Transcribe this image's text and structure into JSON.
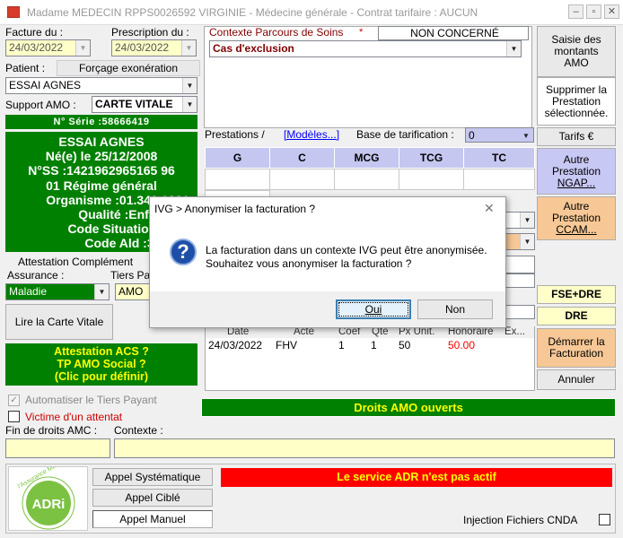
{
  "window": {
    "title": "Madame MEDECIN RPPS0026592 VIRGINIE - Médecine générale - Contrat tarifaire : AUCUN",
    "minimize_icon": "minimize-icon",
    "restore_icon": "restore-icon",
    "close_icon": "close-icon"
  },
  "left": {
    "facture_label": "Facture du :",
    "facture_date": "24/03/2022",
    "prescription_label": "Prescription du :",
    "prescription_date": "24/03/2022",
    "patient_label": "Patient :",
    "forcage_label": "Forçage exonération",
    "patient_name": "ESSAI AGNES",
    "support_label": "Support AMO :",
    "support_value": "CARTE VITALE",
    "serie": "N° Série :58666419",
    "card_lines": [
      "ESSAI AGNES",
      "Né(e) le 25/12/2008",
      "N°SS :1421962965165 96",
      "01 Régime général",
      "Organisme :01.349.0881",
      "Qualité :Enfant",
      "Code Situation :0",
      "Code Ald :3"
    ],
    "attestation_label": "Attestation Complément",
    "assurance_label": "Assurance :",
    "tiers_label": "Tiers Pa",
    "assurance_value": "Maladie",
    "tiers_value": "AMO",
    "lire_carte": "Lire la Carte Vitale",
    "acs_lines": [
      "Attestation ACS ?",
      "TP AMO Social ?",
      "(Clic pour définir)"
    ],
    "automatiser_label": "Automatiser le Tiers Payant",
    "victime_label": "Victime d'un attentat",
    "fin_droits_label": "Fin de droits AMC :",
    "contexte_label": "Contexte :"
  },
  "center": {
    "parcours_label": "Contexte Parcours de Soins",
    "non_concerne": "NON CONCERNÉ",
    "exclusion": "Cas d'exclusion",
    "prestations_label": "Prestations /",
    "modeles_link": "[Modèles...]",
    "base_label": "Base de tarification :",
    "base_value": "0",
    "grid_headers": [
      "G",
      "C",
      "MCG",
      "TCG",
      "TC"
    ],
    "acts_columns": [
      "Date",
      "Acte",
      "Coef",
      "Qté",
      "Px Unit.",
      "Honoraire",
      "Ex..."
    ],
    "acts_rows": [
      {
        "date": "24/03/2022",
        "acte": "FHV",
        "coef": "1",
        "qte": "1",
        "px": "50",
        "honoraire": "50.00",
        "ex": ""
      }
    ],
    "droits_amo": "Droits AMO ouverts"
  },
  "right": {
    "saisie": [
      "Saisie des",
      "montants",
      "AMO"
    ],
    "supprimer": [
      "Supprimer la",
      "Prestation",
      "sélectionnée."
    ],
    "tarifs": "Tarifs €",
    "autre_ngap": [
      "Autre",
      "Prestation",
      "NGAP..."
    ],
    "autre_ccam": [
      "Autre",
      "Prestation",
      "CCAM..."
    ],
    "fse_dre": "FSE+DRE",
    "dre": "DRE",
    "demarrer": [
      "Démarrer la",
      "Facturation"
    ],
    "annuler": "Annuler"
  },
  "bottom": {
    "adri_logo_text": "ADRi",
    "adri_ring_text": "l'Assurance Maladie",
    "appel_systematique": "Appel Systématique",
    "appel_cible": "Appel Ciblé",
    "appel_manuel": "Appel Manuel",
    "adr_status": "Le service ADR n'est pas actif",
    "injection_label": "Injection Fichiers CNDA"
  },
  "dialog": {
    "title": "IVG > Anonymiser la facturation ?",
    "message_line1": "La facturation dans un contexte IVG peut être anonymisée.",
    "message_line2": "Souhaitez vous anonymiser la facturation ?",
    "oui": "Oui",
    "non": "Non",
    "icon": "question-icon",
    "close_icon": "close-icon"
  },
  "colors": {
    "green": "#008000",
    "yellow_field": "#ffffc8",
    "grid_header": "#c5c7f0",
    "ngap_button": "#c8c8f5",
    "ccam_button": "#f7c896",
    "red_status": "#ff0000",
    "honoraire_red": "#ff0000"
  }
}
